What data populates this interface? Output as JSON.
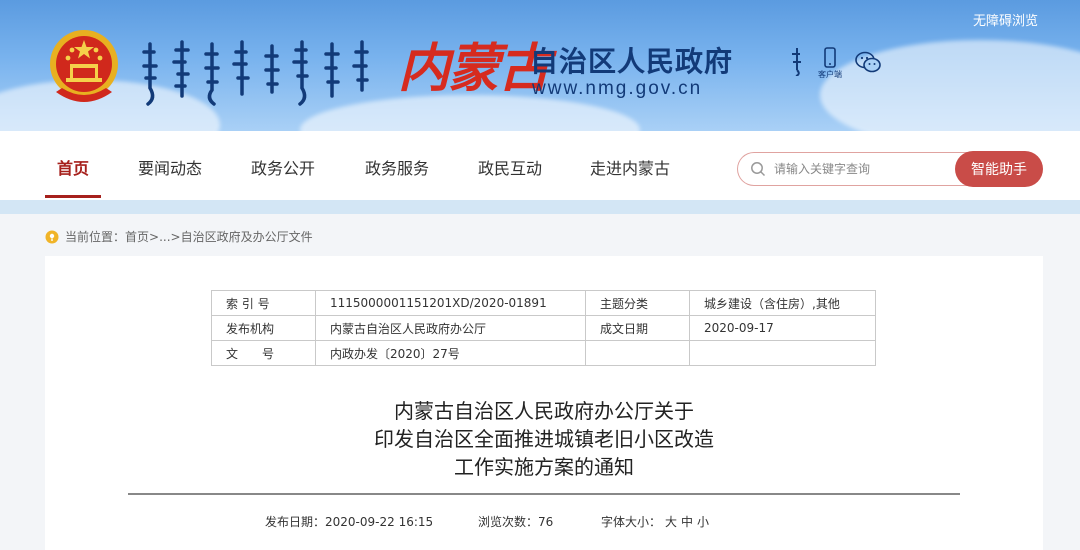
{
  "header": {
    "gov_title": "自治区人民政府",
    "gov_url": "www.nmg.gov.cn",
    "brand_script": "内蒙古",
    "client_label": "客户端",
    "accessibility": "无障碍浏览",
    "colors": {
      "title": "#123a78",
      "brand": "#d62b1f"
    }
  },
  "nav": {
    "items": [
      "首页",
      "要闻动态",
      "政务公开",
      "政务服务",
      "政民互动",
      "走进内蒙古"
    ],
    "active_index": 0,
    "accent": "#a6201c"
  },
  "search": {
    "placeholder": "请输入关键字查询",
    "button_label": "智能助手"
  },
  "breadcrumb": {
    "label": "当前位置：",
    "home": "首页",
    "sep": ">",
    "ellipsis": "...",
    "current": "自治区政府及办公厅文件"
  },
  "meta_table": {
    "rows": [
      {
        "k1": "索 引 号",
        "v1": "1115000001151201XD/2020-01891",
        "k2": "主题分类",
        "v2": "城乡建设（含住房）,其他"
      },
      {
        "k1": "发布机构",
        "v1": "内蒙古自治区人民政府办公厅",
        "k2": "成文日期",
        "v2": "2020-09-17"
      },
      {
        "k1": "文　　号",
        "v1": "内政办发〔2020〕27号",
        "k2": "",
        "v2": ""
      }
    ]
  },
  "document": {
    "title_lines": [
      "内蒙古自治区人民政府办公厅关于",
      "印发自治区全面推进城镇老旧小区改造",
      "工作实施方案的通知"
    ],
    "publish_label": "发布日期：",
    "publish_date": "2020-09-22 16:15",
    "views_label": "浏览次数：",
    "views": "76",
    "font_size_label": "字体大小：",
    "font_sizes": [
      "大",
      "中",
      "小"
    ]
  }
}
